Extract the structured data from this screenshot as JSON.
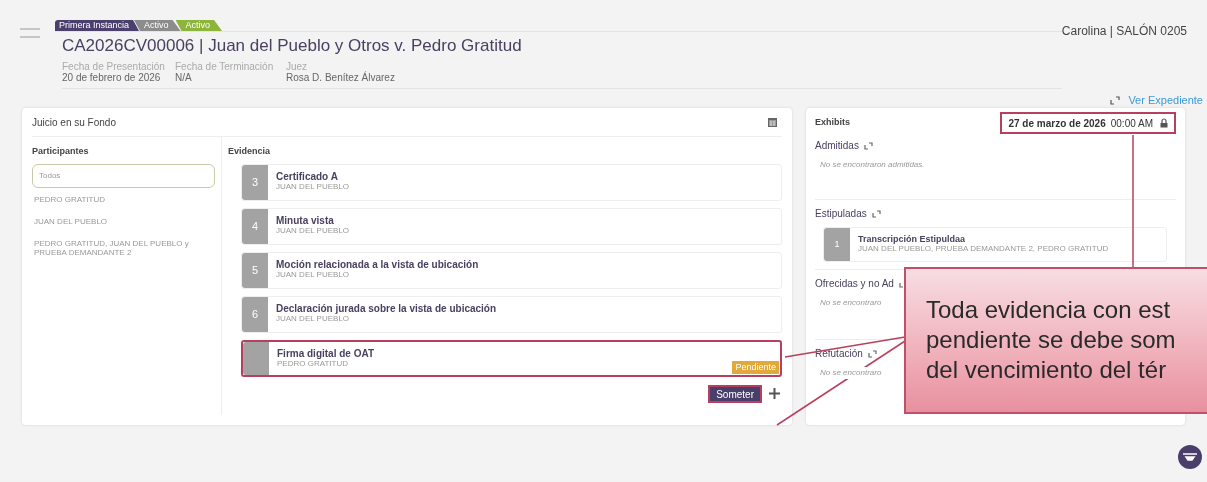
{
  "header": {
    "badges": [
      {
        "label": "Primera Instancia",
        "color": "#4b3f6e"
      },
      {
        "label": "Activo",
        "color": "#8c8c8c"
      },
      {
        "label": "Activo",
        "color": "#8db53c"
      }
    ],
    "case_title": "CA2026CV00006 | Juan del Pueblo y Otros v. Pedro Gratitud",
    "fields": [
      {
        "label": "Fecha de Presentación",
        "value": "20 de febrero de 2026"
      },
      {
        "label": "Fecha de Terminación",
        "value": "N/A"
      },
      {
        "label": "Juez",
        "value": "Rosa D. Benítez Álvarez"
      }
    ],
    "user_location": "Carolina | SALÓN 0205",
    "link": "Ver Expediente"
  },
  "left_panel": {
    "title": "Juicio en su Fondo",
    "participants": {
      "heading": "Participantes",
      "items": [
        {
          "label": "Todos",
          "selected": true
        },
        {
          "label": "PEDRO GRATITUD",
          "selected": false
        },
        {
          "label": "JUAN DEL PUEBLO",
          "selected": false
        },
        {
          "label": "PEDRO GRATITUD, JUAN DEL PUEBLO y PRUEBA DEMANDANTE 2",
          "selected": false
        }
      ]
    },
    "evidence": {
      "heading": "Evidencia",
      "items": [
        {
          "number": "3",
          "title": "Certificado A",
          "party": "JUAN DEL PUEBLO",
          "highlighted": false
        },
        {
          "number": "4",
          "title": "Minuta vista",
          "party": "JUAN DEL PUEBLO",
          "highlighted": false
        },
        {
          "number": "5",
          "title": "Moción relacionada a la vista de ubicación",
          "party": "JUAN DEL PUEBLO",
          "highlighted": false
        },
        {
          "number": "6",
          "title": "Declaración jurada sobre la vista de ubicación",
          "party": "JUAN DEL PUEBLO",
          "highlighted": false
        },
        {
          "title": "Firma digital de OAT",
          "party": "PEDRO GRATITUD",
          "status": "Pendiente",
          "highlighted": true
        }
      ],
      "submit": {
        "label": "Someter",
        "highlighted": true
      }
    }
  },
  "right_panel": {
    "title": "Exhibits",
    "date": "27 de marzo de 2026",
    "time": "00:00 AM",
    "locked": true,
    "highlighted": true,
    "sections": [
      {
        "title": "Admitidas",
        "empty_text": "No se encontraron admitidas."
      },
      {
        "title": "Estipuladas",
        "items": [
          {
            "number": "1",
            "title": "Transcripción Estipuldaa",
            "party": "JUAN DEL PUEBLO, PRUEBA DEMANDANTE 2, PEDRO GRATITUD"
          }
        ]
      },
      {
        "title": "Ofrecidas y no Ad",
        "empty_text": "No se encontraro"
      },
      {
        "title": "Refutación",
        "empty_text": "No se encontraro"
      }
    ]
  },
  "callout": {
    "lines": [
      "Toda evidencia con est",
      "pendiente se debe som",
      "del vencimiento del tér"
    ]
  }
}
